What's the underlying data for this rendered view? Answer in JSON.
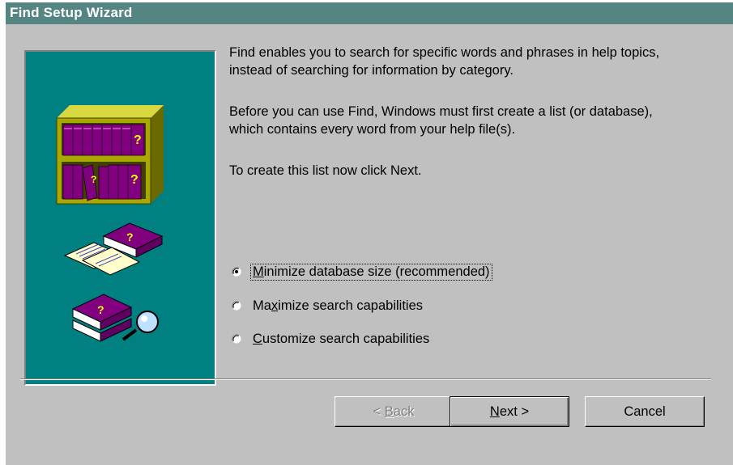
{
  "window": {
    "title": "Find Setup Wizard"
  },
  "intro": {
    "paragraph1": "Find enables you to search for specific words and phrases in help topics, instead of searching for information by category.",
    "paragraph2": "Before you can use Find, Windows must first create a list (or database), which contains every word from your help file(s).",
    "paragraph3": "To create this list now click Next."
  },
  "options": [
    {
      "pre": "",
      "mnemonic": "M",
      "post": "inimize database size (recommended)",
      "selected": true
    },
    {
      "pre": "Ma",
      "mnemonic": "x",
      "post": "imize search capabilities",
      "selected": false
    },
    {
      "pre": "",
      "mnemonic": "C",
      "post": "ustomize search capabilities",
      "selected": false
    }
  ],
  "buttons": {
    "back": {
      "prefix": "< ",
      "mnemonic": "B",
      "rest": "ack",
      "enabled": false
    },
    "next": {
      "mnemonic": "N",
      "rest": "ext >",
      "enabled": true
    },
    "cancel": {
      "label": "Cancel",
      "enabled": true
    }
  },
  "colors": {
    "title_bar": "#548582",
    "dialog_face": "#c0c0c0",
    "picture_background": "#008080",
    "book_purple": "#800080",
    "shelf_olive": "#a8a800",
    "question_mark": "#ffff00"
  },
  "illustration": {
    "icons": [
      "bookshelf-icon",
      "help-books-and-pages-icon",
      "books-with-magnifier-icon"
    ]
  }
}
